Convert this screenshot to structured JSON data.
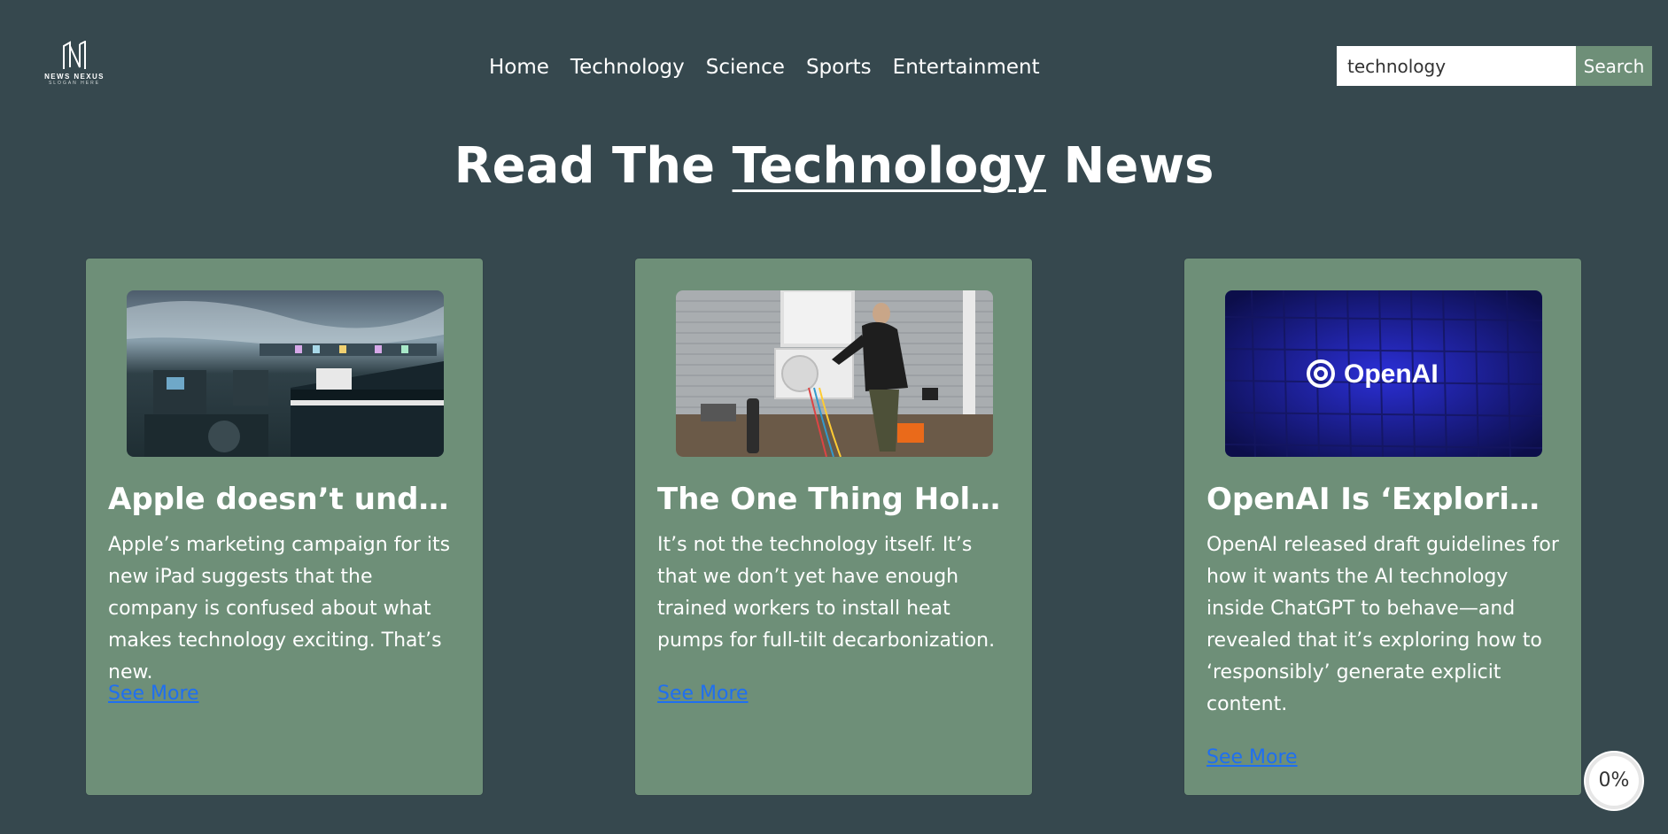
{
  "brand": {
    "name": "NEWS NEXUS",
    "slogan": "SLOGAN HERE"
  },
  "nav": {
    "items": [
      "Home",
      "Technology",
      "Science",
      "Sports",
      "Entertainment"
    ]
  },
  "search": {
    "value": "technology",
    "button_label": "Search"
  },
  "heading": {
    "prefix": "Read The",
    "keyword": "Technology",
    "suffix": "News"
  },
  "articles": [
    {
      "title": "Apple doesn’t underst...",
      "description": "Apple’s marketing campaign for its new iPad suggests that the company is confused about what makes technology exciting. That’s new.",
      "link_label": "See More"
    },
    {
      "title": "The One Thing Holdin...",
      "description": "It’s not the technology itself. It’s that we don’t yet have enough trained workers to install heat pumps for full-tilt decarbonization.",
      "link_label": "See More"
    },
    {
      "title": "OpenAI Is ‘Exploring’ ...",
      "description": "OpenAI released draft guidelines for how it wants the AI technology inside ChatGPT to behave—and revealed that it’s exploring how to ‘responsibly’ generate explicit content.",
      "link_label": "See More",
      "image_text": "OpenAI"
    }
  ],
  "scroll_progress": {
    "label": "0%",
    "percent": 0
  },
  "colors": {
    "background": "#36484e",
    "card": "#6e8f78",
    "link": "#1f6ff0",
    "search_button": "#6e8f78"
  }
}
